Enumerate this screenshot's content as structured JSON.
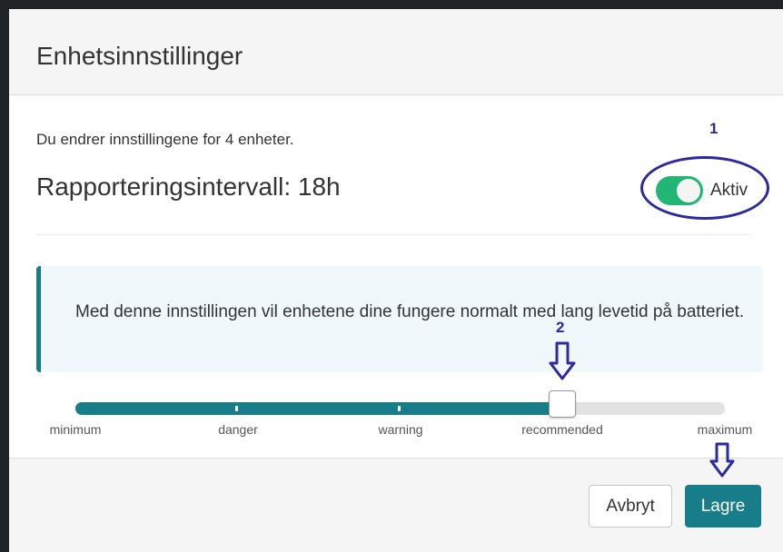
{
  "dialog": {
    "title": "Enhetsinnstillinger",
    "subtitle": "Du endrer innstillingene for 4 enheter.",
    "interval_title": "Rapporteringsintervall: 18h"
  },
  "toggle": {
    "label": "Aktiv",
    "state": "on",
    "color": "#22b573"
  },
  "info": {
    "text": "Med denne innstillingen vil enhetene dine fungere normalt med lang levetid på batteriet."
  },
  "slider": {
    "labels": [
      "minimum",
      "danger",
      "warning",
      "recommended",
      "maximum"
    ],
    "selected": "recommended",
    "value_fraction": 0.75,
    "accent_color": "#177e89"
  },
  "footer": {
    "cancel_label": "Avbryt",
    "save_label": "Lagre"
  },
  "annotations": {
    "marker_1": "1",
    "marker_2": "2",
    "color": "#2d2aa0"
  }
}
